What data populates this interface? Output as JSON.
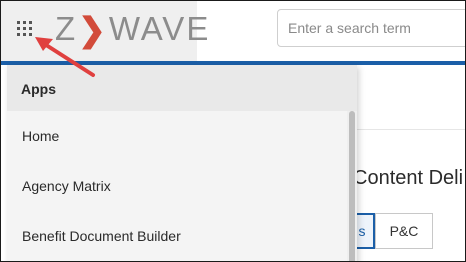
{
  "brand": {
    "logo_text_left": "Z",
    "logo_chevron": "❯",
    "logo_text_right": "WAVE"
  },
  "search": {
    "placeholder": "Enter a search term",
    "value": ""
  },
  "apps_menu": {
    "header": "Apps",
    "items": [
      {
        "label": "Home"
      },
      {
        "label": "Agency Matrix"
      },
      {
        "label": "Benefit Document Builder"
      }
    ]
  },
  "page": {
    "title": "Content Deli",
    "segments": [
      {
        "label": "s",
        "active": true
      },
      {
        "label": "P&C",
        "active": false
      }
    ]
  },
  "colors": {
    "accent": "#1b5fa8",
    "arrow": "#e0403f",
    "logo_chevron": "#d24b3a"
  },
  "icons": {
    "app_launcher": "grid-icon",
    "annotation": "arrow-icon"
  }
}
